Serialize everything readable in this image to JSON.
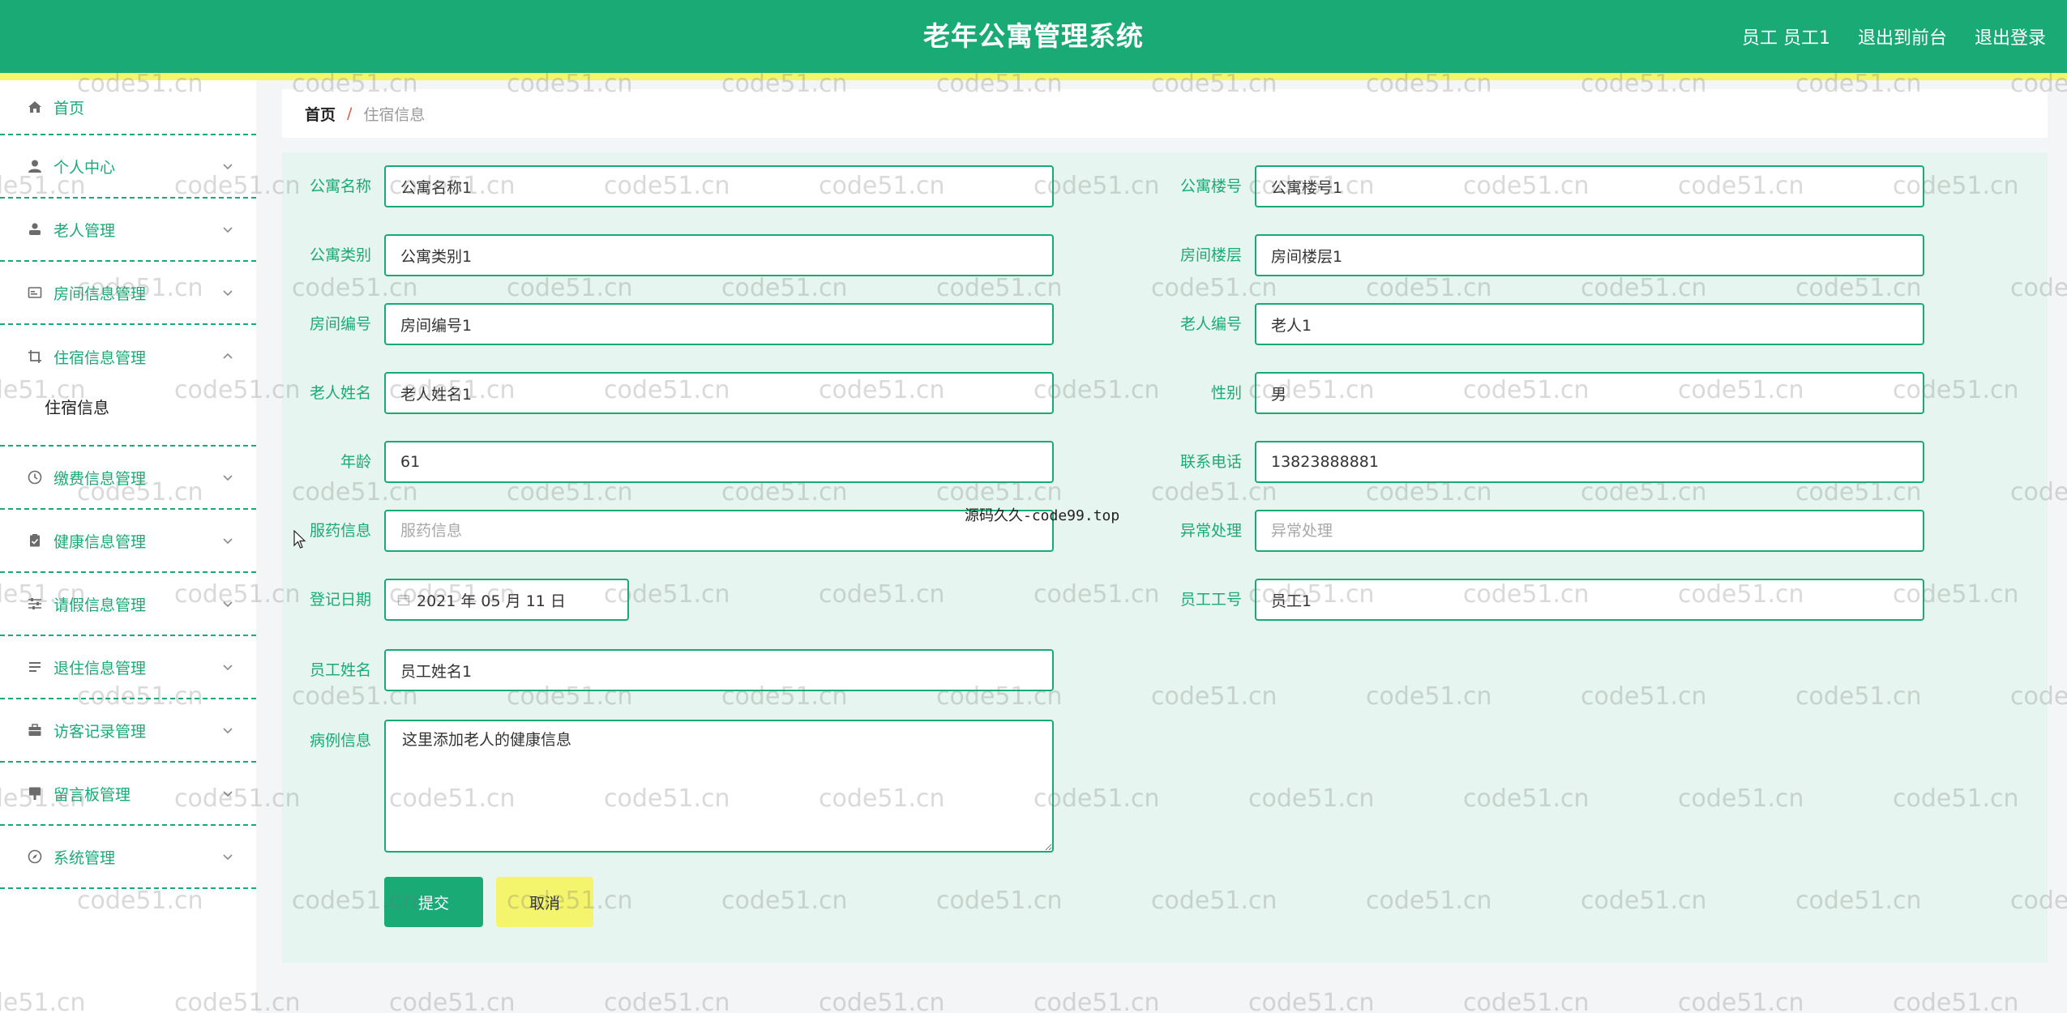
{
  "header": {
    "title": "老年公寓管理系统",
    "user_label": "员工 员工1",
    "front_label": "退出到前台",
    "logout_label": "退出登录"
  },
  "sidebar": {
    "items": [
      {
        "label": "首页",
        "icon": "home-icon"
      },
      {
        "label": "个人中心",
        "icon": "user-icon"
      },
      {
        "label": "老人管理",
        "icon": "person-icon"
      },
      {
        "label": "房间信息管理",
        "icon": "card-icon"
      },
      {
        "label": "住宿信息管理",
        "icon": "crop-icon"
      },
      {
        "label": "缴费信息管理",
        "icon": "clock-icon"
      },
      {
        "label": "健康信息管理",
        "icon": "clipboard-icon"
      },
      {
        "label": "请假信息管理",
        "icon": "sliders-icon"
      },
      {
        "label": "退住信息管理",
        "icon": "list-icon"
      },
      {
        "label": "访客记录管理",
        "icon": "briefcase-icon"
      },
      {
        "label": "留言板管理",
        "icon": "brush-icon"
      },
      {
        "label": "系统管理",
        "icon": "compass-icon"
      }
    ],
    "submenu_label": "住宿信息"
  },
  "breadcrumb": {
    "home": "首页",
    "separator": "/",
    "current": "住宿信息"
  },
  "form": {
    "apartment_name": {
      "label": "公寓名称",
      "value": "公寓名称1"
    },
    "apartment_building": {
      "label": "公寓楼号",
      "value": "公寓楼号1"
    },
    "apartment_type": {
      "label": "公寓类别",
      "value": "公寓类别1"
    },
    "room_floor": {
      "label": "房间楼层",
      "value": "房间楼层1"
    },
    "room_number": {
      "label": "房间编号",
      "value": "房间编号1"
    },
    "elder_number": {
      "label": "老人编号",
      "value": "老人1"
    },
    "elder_name": {
      "label": "老人姓名",
      "value": "老人姓名1"
    },
    "gender": {
      "label": "性别",
      "value": "男"
    },
    "age": {
      "label": "年龄",
      "value": "61"
    },
    "phone": {
      "label": "联系电话",
      "value": "13823888881"
    },
    "medication": {
      "label": "服药信息",
      "value": "",
      "placeholder": "服药信息"
    },
    "abnormal": {
      "label": "异常处理",
      "value": "",
      "placeholder": "异常处理"
    },
    "register_date": {
      "label": "登记日期",
      "value": "2021 年 05 月 11 日"
    },
    "staff_id": {
      "label": "员工工号",
      "value": "员工1"
    },
    "staff_name": {
      "label": "员工姓名",
      "value": "员工姓名1"
    },
    "medical_history": {
      "label": "病例信息",
      "value": "这里添加老人的健康信息"
    },
    "submit_label": "提交",
    "cancel_label": "取消"
  },
  "overlay_text": "源码久久-code99.top",
  "watermark_text": "code51.cn",
  "colors": {
    "primary": "#1aaa76",
    "accent_yellow": "#f4f56c",
    "panel_bg": "#e6f5ef"
  }
}
